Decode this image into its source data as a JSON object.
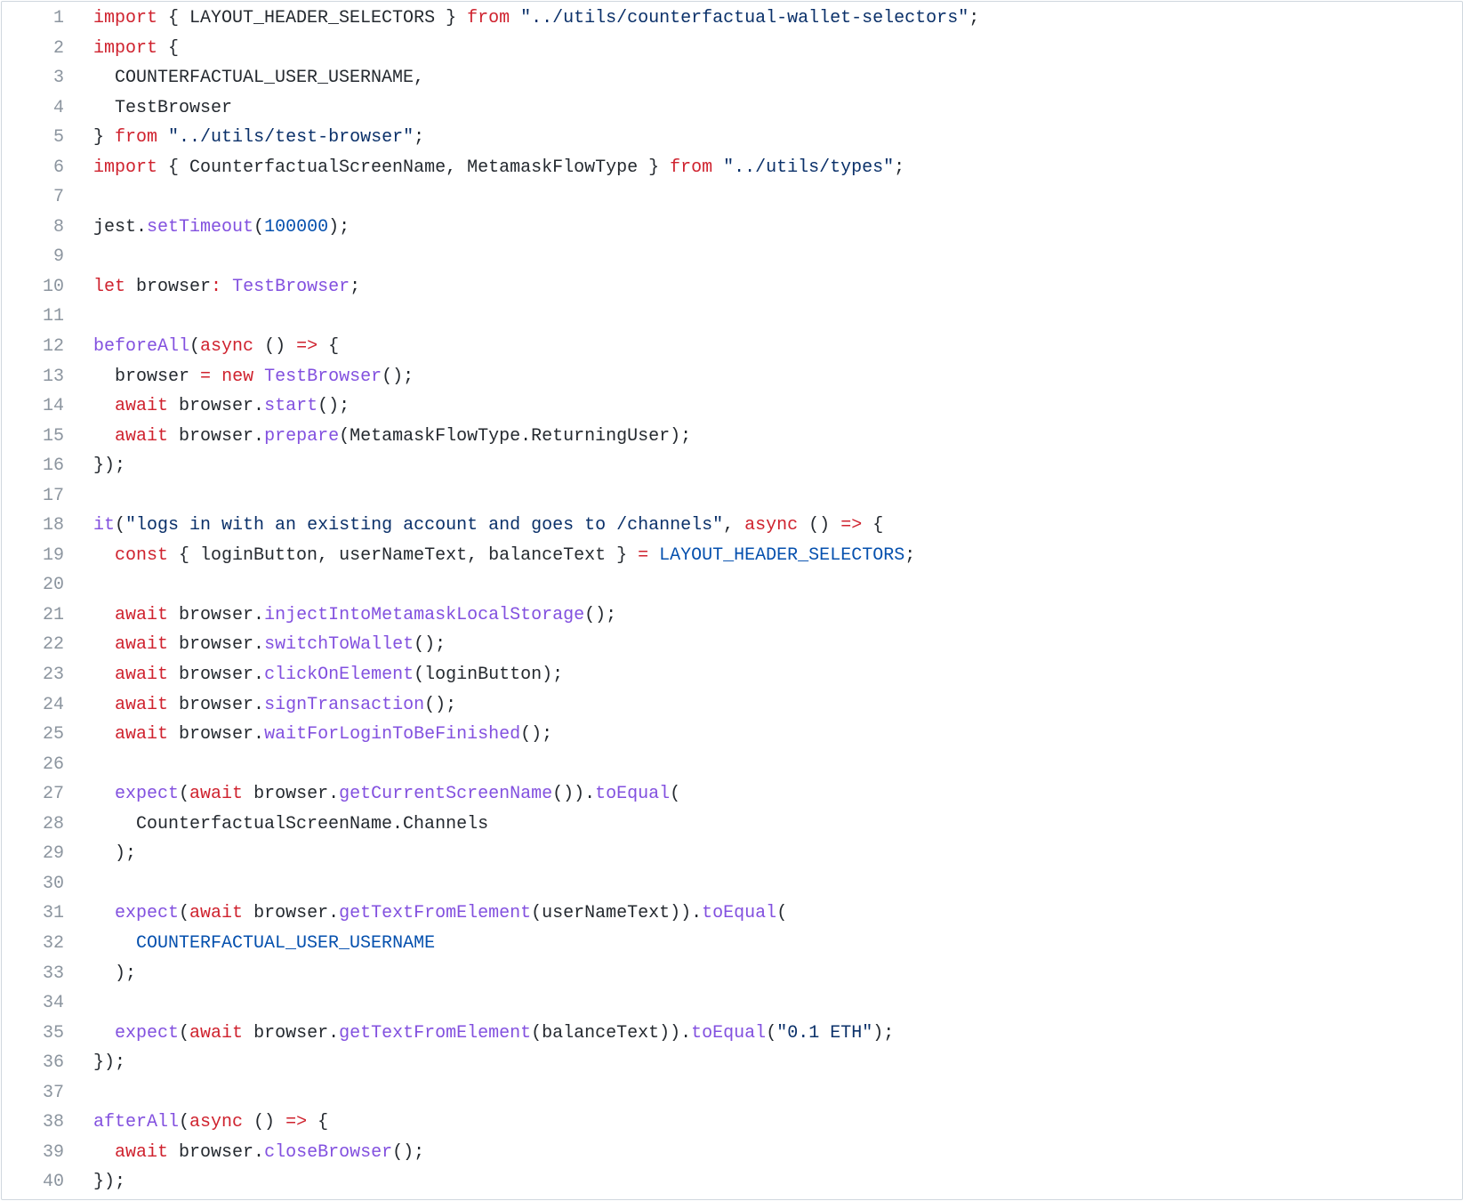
{
  "colors": {
    "keyword": "#cf222e",
    "function": "#8250df",
    "constant": "#0550ae",
    "string": "#0a3069",
    "plain": "#24292f",
    "line_number": "#8c959f",
    "border": "#d0d7de"
  },
  "lines": [
    [
      [
        "kw",
        "import"
      ],
      [
        "pl",
        " { LAYOUT_HEADER_SELECTORS } "
      ],
      [
        "kw",
        "from"
      ],
      [
        "pl",
        " "
      ],
      [
        "st",
        "\"../utils/counterfactual-wallet-selectors\""
      ],
      [
        "pl",
        ";"
      ]
    ],
    [
      [
        "kw",
        "import"
      ],
      [
        "pl",
        " {"
      ]
    ],
    [
      [
        "pl",
        "  COUNTERFACTUAL_USER_USERNAME,"
      ]
    ],
    [
      [
        "pl",
        "  TestBrowser"
      ]
    ],
    [
      [
        "pl",
        "} "
      ],
      [
        "kw",
        "from"
      ],
      [
        "pl",
        " "
      ],
      [
        "st",
        "\"../utils/test-browser\""
      ],
      [
        "pl",
        ";"
      ]
    ],
    [
      [
        "kw",
        "import"
      ],
      [
        "pl",
        " { CounterfactualScreenName, MetamaskFlowType } "
      ],
      [
        "kw",
        "from"
      ],
      [
        "pl",
        " "
      ],
      [
        "st",
        "\"../utils/types\""
      ],
      [
        "pl",
        ";"
      ]
    ],
    [],
    [
      [
        "pl",
        "jest."
      ],
      [
        "fn",
        "setTimeout"
      ],
      [
        "pl",
        "("
      ],
      [
        "cn",
        "100000"
      ],
      [
        "pl",
        ");"
      ]
    ],
    [],
    [
      [
        "kw",
        "let"
      ],
      [
        "pl",
        " browser"
      ],
      [
        "kw",
        ":"
      ],
      [
        "pl",
        " "
      ],
      [
        "fn",
        "TestBrowser"
      ],
      [
        "pl",
        ";"
      ]
    ],
    [],
    [
      [
        "fn",
        "beforeAll"
      ],
      [
        "pl",
        "("
      ],
      [
        "kw",
        "async"
      ],
      [
        "pl",
        " () "
      ],
      [
        "kw",
        "=>"
      ],
      [
        "pl",
        " {"
      ]
    ],
    [
      [
        "pl",
        "  browser "
      ],
      [
        "kw",
        "="
      ],
      [
        "pl",
        " "
      ],
      [
        "kw",
        "new"
      ],
      [
        "pl",
        " "
      ],
      [
        "fn",
        "TestBrowser"
      ],
      [
        "pl",
        "();"
      ]
    ],
    [
      [
        "pl",
        "  "
      ],
      [
        "kw",
        "await"
      ],
      [
        "pl",
        " browser."
      ],
      [
        "fn",
        "start"
      ],
      [
        "pl",
        "();"
      ]
    ],
    [
      [
        "pl",
        "  "
      ],
      [
        "kw",
        "await"
      ],
      [
        "pl",
        " browser."
      ],
      [
        "fn",
        "prepare"
      ],
      [
        "pl",
        "(MetamaskFlowType.ReturningUser);"
      ]
    ],
    [
      [
        "pl",
        "});"
      ]
    ],
    [],
    [
      [
        "fn",
        "it"
      ],
      [
        "pl",
        "("
      ],
      [
        "st",
        "\"logs in with an existing account and goes to /channels\""
      ],
      [
        "pl",
        ", "
      ],
      [
        "kw",
        "async"
      ],
      [
        "pl",
        " () "
      ],
      [
        "kw",
        "=>"
      ],
      [
        "pl",
        " {"
      ]
    ],
    [
      [
        "pl",
        "  "
      ],
      [
        "kw",
        "const"
      ],
      [
        "pl",
        " { loginButton, userNameText, balanceText } "
      ],
      [
        "kw",
        "="
      ],
      [
        "pl",
        " "
      ],
      [
        "cn",
        "LAYOUT_HEADER_SELECTORS"
      ],
      [
        "pl",
        ";"
      ]
    ],
    [],
    [
      [
        "pl",
        "  "
      ],
      [
        "kw",
        "await"
      ],
      [
        "pl",
        " browser."
      ],
      [
        "fn",
        "injectIntoMetamaskLocalStorage"
      ],
      [
        "pl",
        "();"
      ]
    ],
    [
      [
        "pl",
        "  "
      ],
      [
        "kw",
        "await"
      ],
      [
        "pl",
        " browser."
      ],
      [
        "fn",
        "switchToWallet"
      ],
      [
        "pl",
        "();"
      ]
    ],
    [
      [
        "pl",
        "  "
      ],
      [
        "kw",
        "await"
      ],
      [
        "pl",
        " browser."
      ],
      [
        "fn",
        "clickOnElement"
      ],
      [
        "pl",
        "(loginButton);"
      ]
    ],
    [
      [
        "pl",
        "  "
      ],
      [
        "kw",
        "await"
      ],
      [
        "pl",
        " browser."
      ],
      [
        "fn",
        "signTransaction"
      ],
      [
        "pl",
        "();"
      ]
    ],
    [
      [
        "pl",
        "  "
      ],
      [
        "kw",
        "await"
      ],
      [
        "pl",
        " browser."
      ],
      [
        "fn",
        "waitForLoginToBeFinished"
      ],
      [
        "pl",
        "();"
      ]
    ],
    [],
    [
      [
        "pl",
        "  "
      ],
      [
        "fn",
        "expect"
      ],
      [
        "pl",
        "("
      ],
      [
        "kw",
        "await"
      ],
      [
        "pl",
        " browser."
      ],
      [
        "fn",
        "getCurrentScreenName"
      ],
      [
        "pl",
        "())."
      ],
      [
        "fn",
        "toEqual"
      ],
      [
        "pl",
        "("
      ]
    ],
    [
      [
        "pl",
        "    CounterfactualScreenName.Channels"
      ]
    ],
    [
      [
        "pl",
        "  );"
      ]
    ],
    [],
    [
      [
        "pl",
        "  "
      ],
      [
        "fn",
        "expect"
      ],
      [
        "pl",
        "("
      ],
      [
        "kw",
        "await"
      ],
      [
        "pl",
        " browser."
      ],
      [
        "fn",
        "getTextFromElement"
      ],
      [
        "pl",
        "(userNameText))."
      ],
      [
        "fn",
        "toEqual"
      ],
      [
        "pl",
        "("
      ]
    ],
    [
      [
        "pl",
        "    "
      ],
      [
        "cn",
        "COUNTERFACTUAL_USER_USERNAME"
      ]
    ],
    [
      [
        "pl",
        "  );"
      ]
    ],
    [],
    [
      [
        "pl",
        "  "
      ],
      [
        "fn",
        "expect"
      ],
      [
        "pl",
        "("
      ],
      [
        "kw",
        "await"
      ],
      [
        "pl",
        " browser."
      ],
      [
        "fn",
        "getTextFromElement"
      ],
      [
        "pl",
        "(balanceText))."
      ],
      [
        "fn",
        "toEqual"
      ],
      [
        "pl",
        "("
      ],
      [
        "st",
        "\"0.1 ETH\""
      ],
      [
        "pl",
        ");"
      ]
    ],
    [
      [
        "pl",
        "});"
      ]
    ],
    [],
    [
      [
        "fn",
        "afterAll"
      ],
      [
        "pl",
        "("
      ],
      [
        "kw",
        "async"
      ],
      [
        "pl",
        " () "
      ],
      [
        "kw",
        "=>"
      ],
      [
        "pl",
        " {"
      ]
    ],
    [
      [
        "pl",
        "  "
      ],
      [
        "kw",
        "await"
      ],
      [
        "pl",
        " browser."
      ],
      [
        "fn",
        "closeBrowser"
      ],
      [
        "pl",
        "();"
      ]
    ],
    [
      [
        "pl",
        "});"
      ]
    ]
  ]
}
